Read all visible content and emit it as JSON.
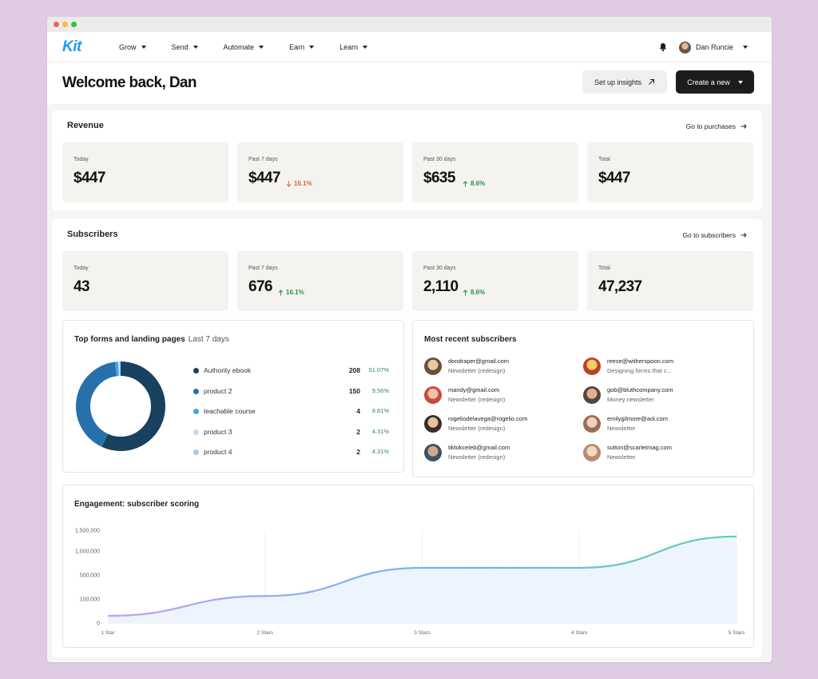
{
  "app": {
    "logo": "Kit",
    "nav": [
      "Grow",
      "Send",
      "Automate",
      "Earn",
      "Learn"
    ],
    "user_name": "Dan Runcie"
  },
  "header": {
    "welcome": "Welcome back, Dan",
    "insights_label": "Set up insights",
    "create_label": "Create a new"
  },
  "revenue": {
    "title": "Revenue",
    "link": "Go to purchases",
    "stats": [
      {
        "label": "Today",
        "value": "$447"
      },
      {
        "label": "Past 7 days",
        "value": "$447",
        "delta": "16.1%",
        "direction": "down"
      },
      {
        "label": "Past 30 days",
        "value": "$635",
        "delta": "8.6%",
        "direction": "up"
      },
      {
        "label": "Total",
        "value": "$447"
      }
    ]
  },
  "subscribers": {
    "title": "Subscribers",
    "link": "Go to subscribers",
    "stats": [
      {
        "label": "Today",
        "value": "43"
      },
      {
        "label": "Past 7 days",
        "value": "676",
        "delta": "16.1%",
        "direction": "up"
      },
      {
        "label": "Past 30 days",
        "value": "2,110",
        "delta": "8.6%",
        "direction": "up"
      },
      {
        "label": "Total",
        "value": "47,237"
      }
    ]
  },
  "top_forms": {
    "title": "Top forms and landing pages",
    "period": "Last 7 days",
    "items": [
      {
        "label": "Authority ebook",
        "count": "208",
        "pct": "51.07%",
        "value": 208,
        "color": "#18405f"
      },
      {
        "label": "product 2",
        "count": "150",
        "pct": "9.56%",
        "value": 150,
        "color": "#2870aa"
      },
      {
        "label": "teachable course",
        "count": "4",
        "pct": "8.81%",
        "value": 4,
        "color": "#42a4ea"
      },
      {
        "label": "product 3",
        "count": "2",
        "pct": "4.31%",
        "value": 2,
        "color": "#bcdcf5"
      },
      {
        "label": "product 4",
        "count": "2",
        "pct": "4.31%",
        "value": 2,
        "color": "#9fcdf0"
      }
    ]
  },
  "recent": {
    "title": "Most recent subscribers",
    "items": [
      {
        "email": "dondraper@gmail.com",
        "list": "Newsletter (redesign)",
        "colors": [
          "#e7c9a6",
          "#6d4d36"
        ]
      },
      {
        "email": "reese@witherspoon.com",
        "list": "Designing forms that c...",
        "colors": [
          "#f1cf6c",
          "#c53d2a"
        ]
      },
      {
        "email": "mandy@gmail.com",
        "list": "Newsletter (redesign)",
        "colors": [
          "#f1c1a3",
          "#c84a3c"
        ]
      },
      {
        "email": "gob@bluthcompany.com",
        "list": "Money newsletter",
        "colors": [
          "#d9b396",
          "#55453a"
        ]
      },
      {
        "email": "rogeliodelavega@rogelio.com",
        "list": "Newsletter (redesign)",
        "colors": [
          "#e3c1a2",
          "#3a2d28"
        ]
      },
      {
        "email": "emilygilmore@aol.com",
        "list": "Newsletter",
        "colors": [
          "#f1d0bb",
          "#9f6a58"
        ]
      },
      {
        "email": "tiktokceleb@gmail.com",
        "list": "Newsletter (redesign)",
        "colors": [
          "#d3a784",
          "#365566"
        ]
      },
      {
        "email": "sutton@scarletmag.com",
        "list": "Newsletter",
        "colors": [
          "#f3d9c3",
          "#b98b71"
        ]
      }
    ]
  },
  "engagement": {
    "title": "Engagement: subscriber scoring"
  },
  "chart_data": {
    "type": "area",
    "title": "Engagement: subscriber scoring",
    "categories": [
      "1 Star",
      "2 Stars",
      "3 Stars",
      "4 Stars",
      "5 Stars"
    ],
    "values": [
      30000,
      150000,
      650000,
      650000,
      1350000
    ],
    "y_ticks": [
      "1,500,000",
      "1,000,000",
      "500,000",
      "100,000",
      "0"
    ],
    "y_tick_values": [
      1500000,
      1000000,
      500000,
      100000,
      0
    ],
    "legend": "none",
    "grid": "vertical",
    "colors": {
      "line_start": "#c3a1f2",
      "line_mid": "#71b6ea",
      "line_end": "#5ad1b6",
      "fill": "#eef4fd"
    }
  }
}
